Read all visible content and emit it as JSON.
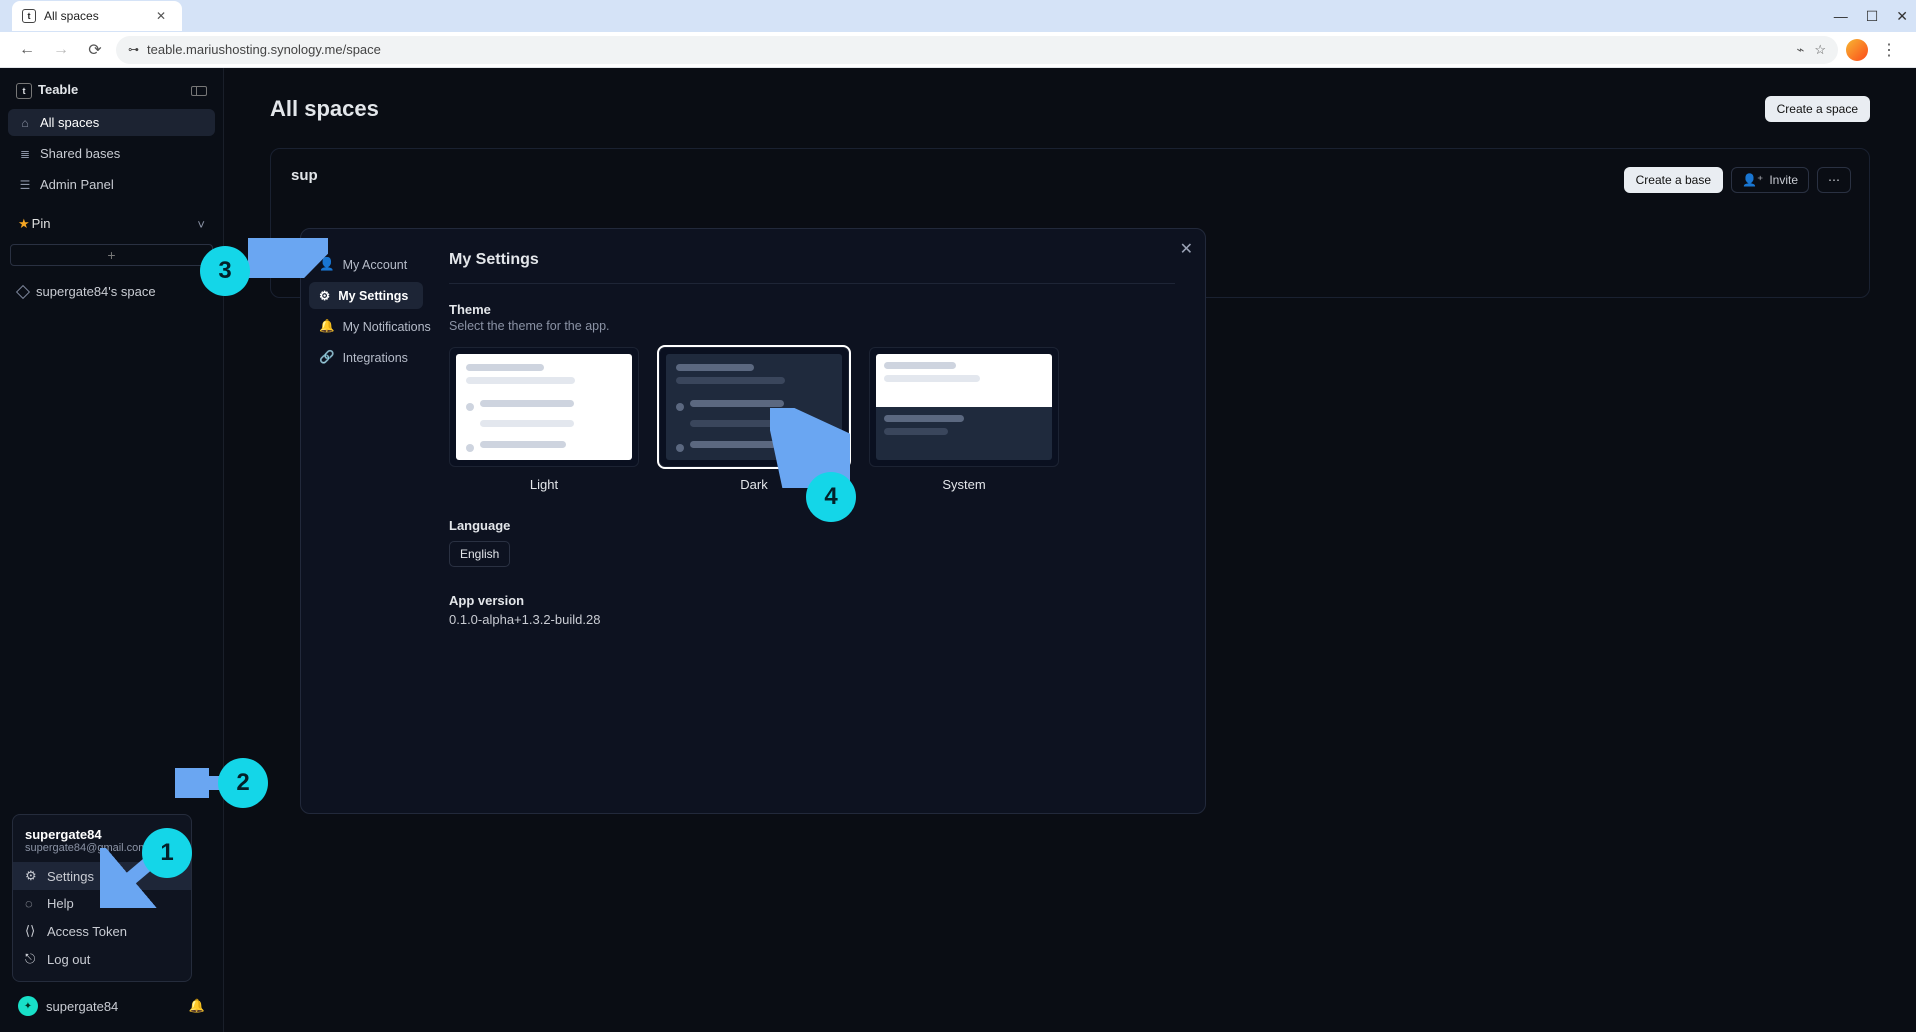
{
  "browser": {
    "tab_title": "All spaces",
    "url": "teable.mariushosting.synology.me/space"
  },
  "sidebar": {
    "brand": "Teable",
    "items": [
      {
        "label": "All spaces",
        "icon": "home"
      },
      {
        "label": "Shared bases",
        "icon": "db"
      },
      {
        "label": "Admin Panel",
        "icon": "user"
      }
    ],
    "pin_label": "Pin",
    "space_link": "supergate84's space"
  },
  "usermenu": {
    "name": "supergate84",
    "email": "supergate84@gmail.com",
    "items": [
      {
        "label": "Settings",
        "icon": "gear"
      },
      {
        "label": "Help",
        "icon": "help"
      },
      {
        "label": "Access Token",
        "icon": "code"
      },
      {
        "label": "Log out",
        "icon": "exit"
      }
    ]
  },
  "footer_user": "supergate84",
  "main": {
    "title": "All spaces",
    "create_space": "Create a space",
    "space_title": "sup",
    "create_base": "Create a base",
    "invite": "Invite"
  },
  "modal": {
    "side": [
      {
        "label": "My Account"
      },
      {
        "label": "My Settings"
      },
      {
        "label": "My Notifications"
      },
      {
        "label": "Integrations"
      }
    ],
    "title": "My Settings",
    "theme_title": "Theme",
    "theme_sub": "Select the theme for the app.",
    "themes": [
      {
        "label": "Light"
      },
      {
        "label": "Dark"
      },
      {
        "label": "System"
      }
    ],
    "lang_title": "Language",
    "lang_value": "English",
    "ver_title": "App version",
    "ver_value": "0.1.0-alpha+1.3.2-build.28"
  },
  "annotations": {
    "b1": "1",
    "b2": "2",
    "b3": "3",
    "b4": "4"
  }
}
